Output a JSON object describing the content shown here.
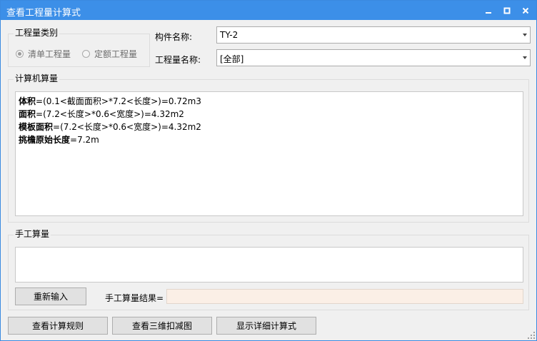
{
  "window": {
    "title": "查看工程量计算式",
    "titlebar_color": "#3c8fe8"
  },
  "quantity_type": {
    "group_label": "工程量类别",
    "options": [
      {
        "label": "清单工程量",
        "selected": true
      },
      {
        "label": "定额工程量",
        "selected": false
      }
    ]
  },
  "component": {
    "label": "构件名称:",
    "value": "TY-2"
  },
  "quantity_name": {
    "label": "工程量名称:",
    "value": "[全部]"
  },
  "computer_calc": {
    "group_label": "计算机算量",
    "lines": [
      {
        "name": "体积",
        "expr": "=(0.1<截面面积>*7.2<长度>)=0.72m3"
      },
      {
        "name": "面积",
        "expr": "=(7.2<长度>*0.6<宽度>)=4.32m2"
      },
      {
        "name": "模板面积",
        "expr": "=(7.2<长度>*0.6<宽度>)=4.32m2"
      },
      {
        "name": "挑檐原始长度",
        "expr": "=7.2m"
      }
    ]
  },
  "manual_calc": {
    "group_label": "手工算量",
    "input_value": "",
    "reenter_label": "重新输入",
    "result_label": "手工算量结果=",
    "result_value": "",
    "result_bg_color": "#fbefe6"
  },
  "bottom_buttons": {
    "view_rules": "查看计算规则",
    "view_3d": "查看三维扣减图",
    "show_detail": "显示详细计算式"
  },
  "icons": {
    "minimize": "minimize-icon",
    "maximize": "maximize-icon",
    "close": "close-icon",
    "dropdown": "chevron-down-icon",
    "grip": "resize-grip-icon"
  }
}
